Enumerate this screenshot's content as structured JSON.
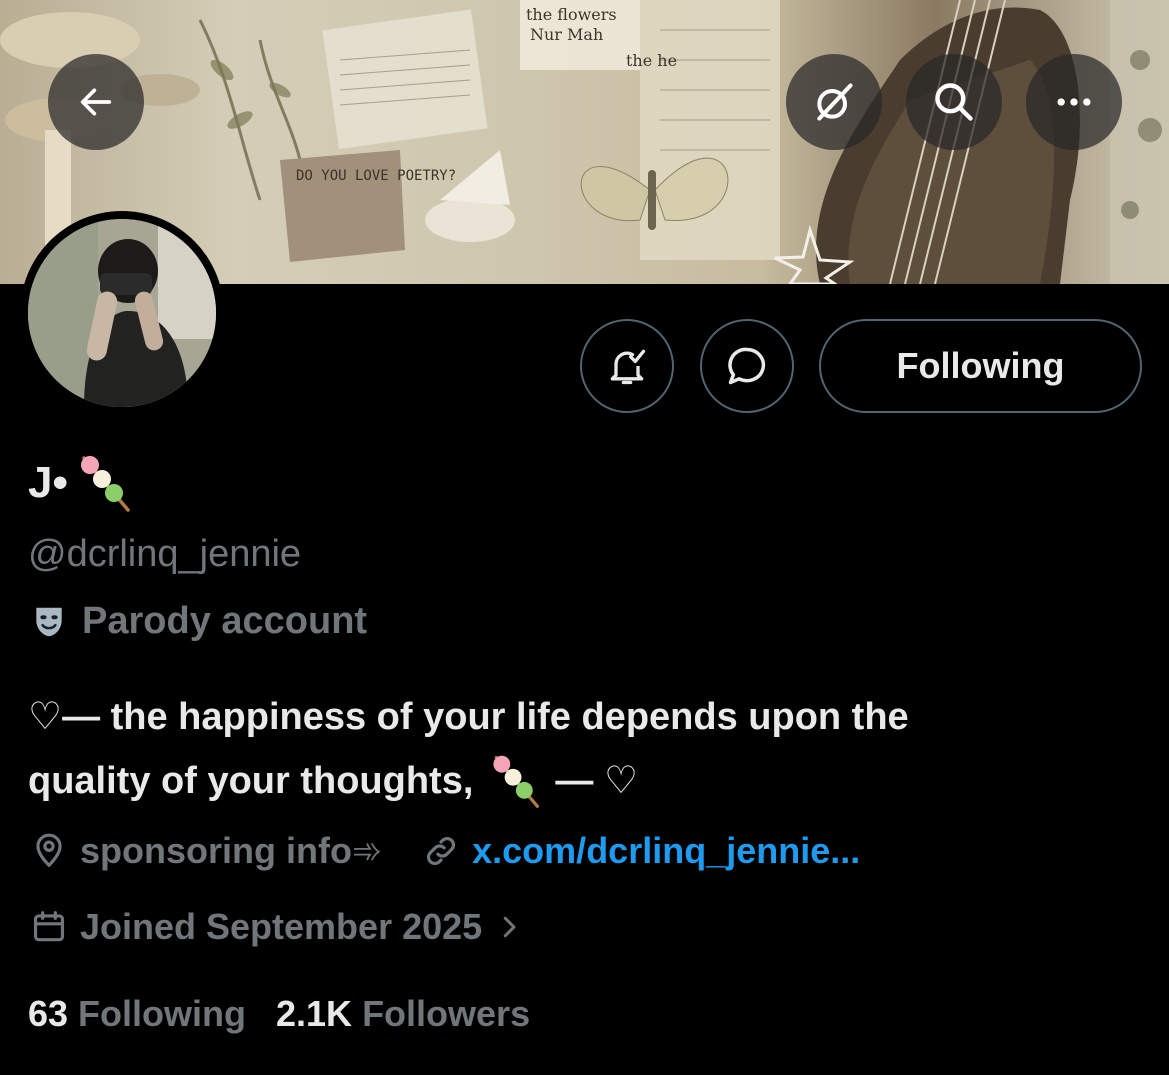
{
  "header": {
    "back_icon": "arrow-left-icon",
    "grok_icon": "grok-icon",
    "search_icon": "search-icon",
    "more_icon": "more-horizontal-icon"
  },
  "banner": {
    "note_text": "DO YOU LOVE POETRY?",
    "scrap_text_1": "the flowers",
    "scrap_text_2": "Nur Mah",
    "scrap_text_3": "the he"
  },
  "actions": {
    "notifications_icon": "bell-check-icon",
    "message_icon": "message-bubble-icon",
    "follow_label": "Following"
  },
  "profile": {
    "display_name": "J•",
    "name_emoji": "dango-icon",
    "handle": "@dcrlinq_jennie",
    "parody_label": "Parody account",
    "bio_line1": "♡— the happiness of your life depends upon the",
    "bio_line2_start": "quality of your thoughts,",
    "bio_line2_end": "— ♡",
    "location": "sponsoring info➾",
    "website": "x.com/dcrlinq_jennie...",
    "joined": "Joined September 2025"
  },
  "stats": {
    "following_count": "63",
    "following_label": "Following",
    "followers_count": "2.1K",
    "followers_label": "Followers"
  },
  "colors": {
    "background": "#000000",
    "text_primary": "#e7e9ea",
    "text_secondary": "#71767b",
    "link": "#1d9bf0",
    "border": "#536471"
  }
}
